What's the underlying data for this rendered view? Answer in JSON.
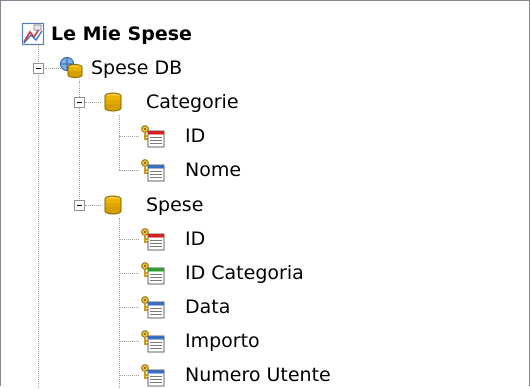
{
  "tree": {
    "root": {
      "label": "Le Mie Spese",
      "icon": "chart-document-icon"
    },
    "database": {
      "label": "Spese DB",
      "icon": "database-connection-icon",
      "expanded": true
    },
    "tables": [
      {
        "label": "Categorie",
        "icon": "table-icon",
        "expanded": true,
        "fields": [
          {
            "label": "ID",
            "icon": "primary-key-field-icon"
          },
          {
            "label": "Nome",
            "icon": "field-icon"
          }
        ]
      },
      {
        "label": "Spese",
        "icon": "table-icon",
        "expanded": true,
        "fields": [
          {
            "label": "ID",
            "icon": "primary-key-field-icon"
          },
          {
            "label": "ID Categoria",
            "icon": "foreign-key-field-icon"
          },
          {
            "label": "Data",
            "icon": "field-icon"
          },
          {
            "label": "Importo",
            "icon": "field-icon"
          },
          {
            "label": "Numero Utente",
            "icon": "field-icon"
          }
        ]
      }
    ]
  },
  "colors": {
    "connector": "#a0a0a0",
    "table_icon": "#e8b400",
    "key_icon": "#d9a300",
    "pk_header": "#d32020",
    "fk_header": "#2e9e2e",
    "field_header": "#3a6fc0"
  }
}
